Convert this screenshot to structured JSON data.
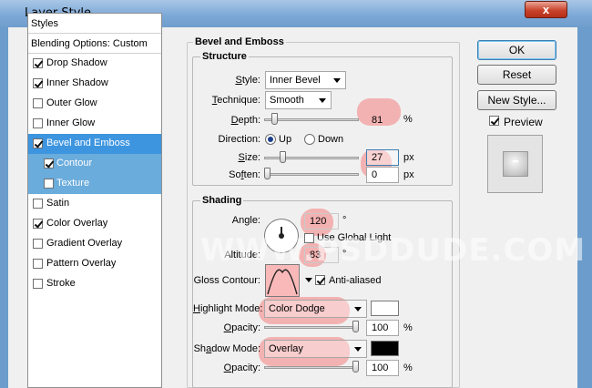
{
  "window": {
    "title": "Layer Style",
    "close_glyph": "x"
  },
  "styles_list": {
    "header": "Styles",
    "blending_options": "Blending Options: Custom",
    "items": [
      {
        "label": "Drop Shadow",
        "checked": true
      },
      {
        "label": "Inner Shadow",
        "checked": true
      },
      {
        "label": "Outer Glow",
        "checked": false
      },
      {
        "label": "Inner Glow",
        "checked": false
      },
      {
        "label": "Bevel and Emboss",
        "checked": true,
        "selected": true
      },
      {
        "label": "Contour",
        "checked": true,
        "sub": true
      },
      {
        "label": "Texture",
        "checked": false,
        "sub": true
      },
      {
        "label": "Satin",
        "checked": false
      },
      {
        "label": "Color Overlay",
        "checked": true
      },
      {
        "label": "Gradient Overlay",
        "checked": false
      },
      {
        "label": "Pattern Overlay",
        "checked": false
      },
      {
        "label": "Stroke",
        "checked": false
      }
    ]
  },
  "bevel": {
    "section_title": "Bevel and Emboss",
    "structure": {
      "title": "Structure",
      "style_label": "Style:",
      "style_value": "Inner Bevel",
      "technique_label": "Technique:",
      "technique_value": "Smooth",
      "depth_label": "Depth:",
      "depth_value": "81",
      "depth_unit": "%",
      "direction_label": "Direction:",
      "direction_up": "Up",
      "direction_down": "Down",
      "direction_selected": "Up",
      "size_label": "Size:",
      "size_value": "27",
      "size_unit": "px",
      "soften_label": "Soften:",
      "soften_value": "0",
      "soften_unit": "px"
    },
    "shading": {
      "title": "Shading",
      "angle_label": "Angle:",
      "angle_value": "120",
      "angle_unit": "°",
      "global_light_label": "Use Global Light",
      "global_light_checked": false,
      "altitude_label": "Altitude:",
      "altitude_value": "83",
      "altitude_unit": "°",
      "gloss_label": "Gloss Contour:",
      "anti_aliased_label": "Anti-aliased",
      "anti_aliased_checked": true,
      "highlight_mode_label": "Highlight Mode:",
      "highlight_mode_value": "Color Dodge",
      "highlight_color": "#ffffff",
      "highlight_opacity_label": "Opacity:",
      "highlight_opacity_value": "100",
      "highlight_opacity_unit": "%",
      "shadow_mode_label": "Shadow Mode:",
      "shadow_mode_value": "Overlay",
      "shadow_color": "#000000",
      "shadow_opacity_label": "Opacity:",
      "shadow_opacity_value": "100",
      "shadow_opacity_unit": "%"
    }
  },
  "buttons": {
    "ok": "OK",
    "reset": "Reset",
    "new_style": "New Style...",
    "preview_label": "Preview",
    "preview_checked": true
  },
  "watermark": "WWW.PSDDUDE.COM",
  "colors": {
    "highlight_marker": "#f68080",
    "selection": "#3d95e0",
    "sub_item": "#6aacdc"
  }
}
